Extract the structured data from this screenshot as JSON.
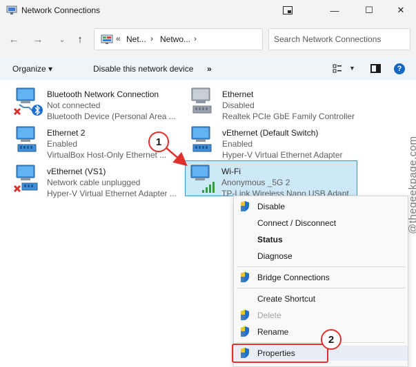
{
  "window": {
    "title": "Network Connections",
    "min_glyph": "—",
    "max_glyph": "☐",
    "close_glyph": "✕"
  },
  "address": {
    "chevron": "«",
    "crumbs": [
      "Net...",
      "Netwo..."
    ],
    "separator": "›",
    "search_placeholder": "Search Network Connections"
  },
  "commands": {
    "organize": "Organize ▾",
    "disable": "Disable this network device",
    "more": "»",
    "help": "?"
  },
  "adapters": [
    {
      "name": "Bluetooth Network Connection",
      "status": "Not connected",
      "device": "Bluetooth Device (Personal Area ...",
      "icon": "bluetooth-adapter-icon",
      "error": true
    },
    {
      "name": "Ethernet",
      "status": "Disabled",
      "device": "Realtek PCIe GbE Family Controller",
      "icon": "ethernet-disabled-icon",
      "error": false
    },
    {
      "name": "Ethernet 2",
      "status": "Enabled",
      "device": "VirtualBox Host-Only Ethernet ...",
      "icon": "ethernet-icon",
      "error": false
    },
    {
      "name": "vEthernet (Default Switch)",
      "status": "Enabled",
      "device": "Hyper-V Virtual Ethernet Adapter",
      "icon": "ethernet-icon",
      "error": false
    },
    {
      "name": "vEthernet (VS1)",
      "status": "Network cable unplugged",
      "device": "Hyper-V Virtual Ethernet Adapter ...",
      "icon": "ethernet-unplugged-icon",
      "error": true
    },
    {
      "name": "Wi-Fi",
      "status": "Anonymous _5G 2",
      "device": "TP-Link Wireless Nano USB Adapt...",
      "icon": "wifi-adapter-icon",
      "selected": true
    }
  ],
  "context_menu": {
    "items": [
      {
        "label": "Disable",
        "shield": true
      },
      {
        "label": "Connect / Disconnect",
        "shield": false
      },
      {
        "label": "Status",
        "shield": false,
        "bold": true
      },
      {
        "label": "Diagnose",
        "shield": false
      },
      {
        "label": "Bridge Connections",
        "shield": true
      },
      {
        "label": "Create Shortcut",
        "shield": false
      },
      {
        "label": "Delete",
        "shield": true,
        "disabled": true
      },
      {
        "label": "Rename",
        "shield": true
      },
      {
        "label": "Properties",
        "shield": true,
        "highlight": true
      }
    ]
  },
  "annotations": {
    "step1": "1",
    "step2": "2"
  },
  "watermark": "@thegeekpage.com",
  "colors": {
    "accent": "#1667c4",
    "selection": "#cde8f7",
    "annotation": "#e0302d"
  }
}
